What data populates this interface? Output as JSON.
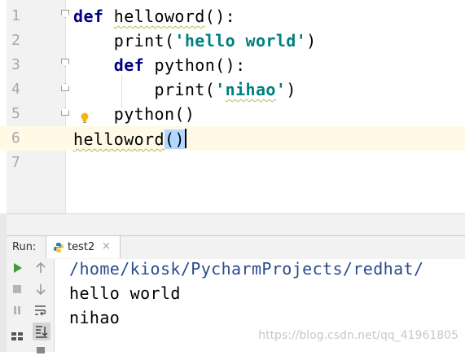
{
  "editor": {
    "lines": [
      {
        "num": "1",
        "parts": [
          {
            "t": "def",
            "c": "kw"
          },
          {
            "t": " ",
            "c": ""
          },
          {
            "t": "helloword",
            "c": "squig"
          },
          {
            "t": "():",
            "c": ""
          }
        ]
      },
      {
        "num": "2",
        "parts": [
          {
            "t": "    print(",
            "c": ""
          },
          {
            "t": "'hello world'",
            "c": "str"
          },
          {
            "t": ")",
            "c": ""
          }
        ]
      },
      {
        "num": "3",
        "parts": [
          {
            "t": "    ",
            "c": ""
          },
          {
            "t": "def",
            "c": "kw"
          },
          {
            "t": " python():",
            "c": ""
          }
        ]
      },
      {
        "num": "4",
        "parts": [
          {
            "t": "        print(",
            "c": ""
          },
          {
            "t": "'",
            "c": "str"
          },
          {
            "t": "nihao",
            "c": "str squig"
          },
          {
            "t": "'",
            "c": "str"
          },
          {
            "t": ")",
            "c": ""
          }
        ]
      },
      {
        "num": "5",
        "parts": [
          {
            "t": "    python()",
            "c": ""
          }
        ]
      },
      {
        "num": "6",
        "parts": [
          {
            "t": "helloword",
            "c": "squig"
          },
          {
            "t": "()",
            "c": "sel"
          }
        ]
      },
      {
        "num": "7",
        "parts": []
      }
    ],
    "current_line": "6"
  },
  "run_panel": {
    "label": "Run:",
    "tab": {
      "name": "test2",
      "close": "×",
      "icon": "python-icon"
    }
  },
  "toolbar": {
    "icons": [
      "run-icon",
      "up-arrow-icon",
      "stop-icon",
      "down-arrow-icon",
      "pause-icon",
      "soft-wrap-icon",
      "layout-icon",
      "scroll-to-end-icon"
    ]
  },
  "console": {
    "lines": [
      "/home/kiosk/PycharmProjects/redhat/",
      "hello world",
      "nihao"
    ]
  },
  "watermark": "https://blog.csdn.net/qq_41961805",
  "colors": {
    "keyword": "#000080",
    "string": "#008080",
    "selection": "#b3d7ff",
    "current_line": "#fff9e5",
    "run_green": "#3d9c3a"
  }
}
